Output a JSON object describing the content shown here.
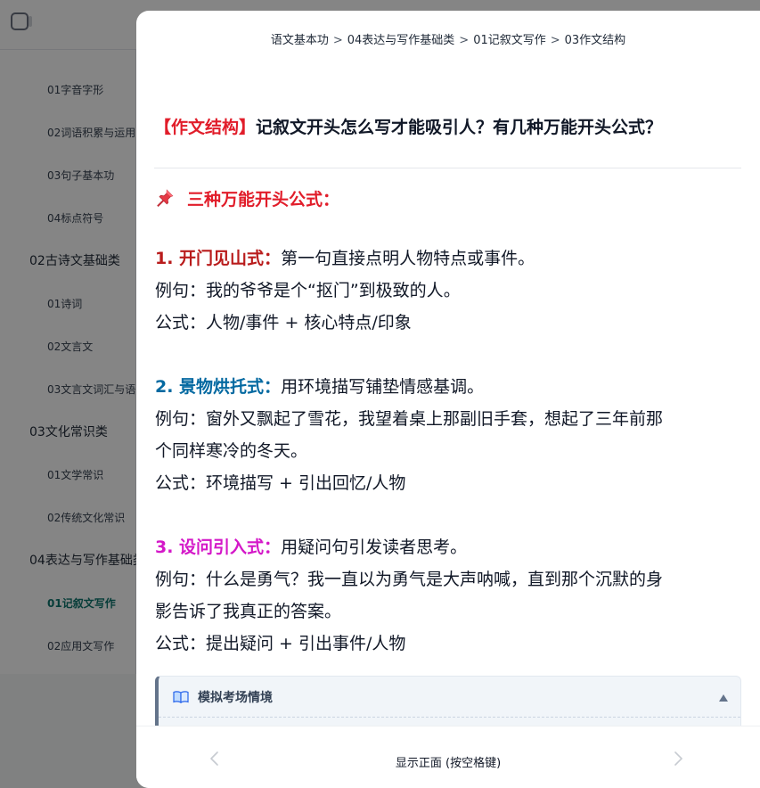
{
  "sidebar": {
    "items": [
      {
        "label": "01字音字形"
      },
      {
        "label": "02词语积累与运用"
      },
      {
        "label": "03句子基本功"
      },
      {
        "label": "04标点符号"
      },
      {
        "label": "02古诗文基础类"
      },
      {
        "label": "01诗词"
      },
      {
        "label": "02文言文"
      },
      {
        "label": "03文言文词汇与语法"
      },
      {
        "label": "03文化常识类"
      },
      {
        "label": "01文学常识"
      },
      {
        "label": "02传统文化常识"
      },
      {
        "label": "04表达与写作基础类"
      },
      {
        "label": "01记叙文写作"
      },
      {
        "label": "02应用文写作"
      }
    ]
  },
  "breadcrumb": {
    "items": [
      "语文基本功",
      "04表达与写作基础类",
      "01记叙文写作",
      "03作文结构"
    ],
    "separator": ">"
  },
  "card": {
    "tag": "【作文结构】",
    "question": "记叙文开头怎么写才能吸引人？有几种万能开头公式？",
    "section_title": "三种万能开头公式：",
    "methods": [
      {
        "label": "1.  开门见山式：",
        "desc": "第一句直接点明人物特点或事件。",
        "example": "例句：我的爷爷是个“抠门”到极致的人。",
        "formula": "公式：人物/事件 + 核心特点/印象",
        "color": "#b91c1c"
      },
      {
        "label": "2.  景物烘托式：",
        "desc": "用环境描写铺垫情感基调。",
        "example_line1": "例句：窗外又飘起了雪花，我望着桌上那副旧手套，想起了三年前那",
        "example_line2": "个同样寒冷的冬天。",
        "formula": "公式：环境描写 + 引出回忆/人物",
        "color": "#0369a1"
      },
      {
        "label": "3.  设问引入式：",
        "desc": "用疑问句引发读者思考。",
        "example_line1": "例句：什么是勇气？我一直以为勇气是大声呐喊，直到那个沉默的身",
        "example_line2": "影告诉了我真正的答案。",
        "formula": "公式：提出疑问 + 引出事件/人物",
        "color": "#d418c8"
      }
    ],
    "scenario_title": "模拟考场情境"
  },
  "footer": {
    "flip_label": "显示正面 (按空格键)"
  },
  "icons": {
    "pin": "pushpin-icon",
    "book": "open-book-icon",
    "prev": "chevron-left-icon",
    "next": "chevron-right-icon",
    "collapse": "caret-up-icon"
  },
  "colors": {
    "accent_red": "#e11d2a",
    "active_nav": "#0f766e"
  }
}
